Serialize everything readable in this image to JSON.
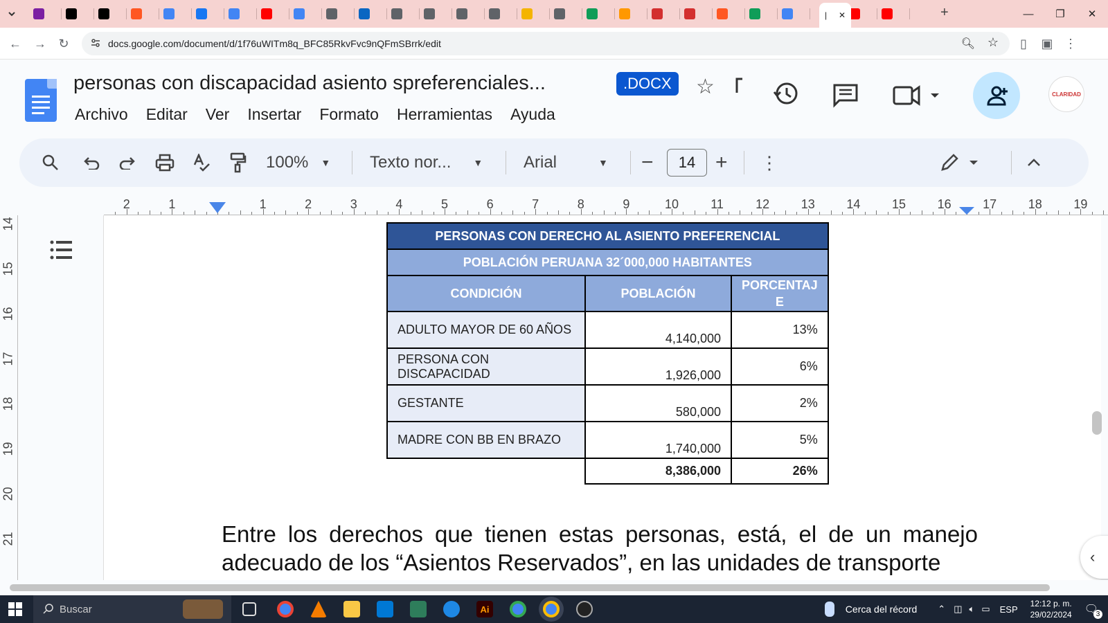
{
  "browser": {
    "active_tab_label": "|",
    "url": "docs.google.com/document/d/1f76uWITm8q_BFC85RkvFvc9nQFmSBrrk/edit",
    "tab_colors": [
      "#7b1fa2",
      "#000000",
      "#000000",
      "#ff5722",
      "#4285f4",
      "#1877f2",
      "#4285f4",
      "#ff0000",
      "#4285f4",
      "#5f6368",
      "#0a66c2",
      "#5f6368",
      "#5f6368",
      "#5f6368",
      "#5f6368",
      "#f4b400",
      "#5f6368",
      "#0f9d58",
      "#ff9800",
      "#d32f2f",
      "#d32f2f",
      "#ff5722",
      "#0f9d58",
      "#4285f4",
      "#ff0000",
      "#ff0000"
    ]
  },
  "docs": {
    "title": "personas con discapacidad asiento spreferenciales...",
    "format_badge": ".DOCX",
    "menu": [
      "Archivo",
      "Editar",
      "Ver",
      "Insertar",
      "Formato",
      "Herramientas",
      "Ayuda"
    ],
    "avatar_text": "CLARIDAD"
  },
  "toolbar": {
    "zoom": "100%",
    "style": "Texto nor...",
    "font": "Arial",
    "font_size": "14"
  },
  "ruler": {
    "horizontal": [
      "2",
      "1",
      "1",
      "2",
      "3",
      "4",
      "5",
      "6",
      "7",
      "8",
      "9",
      "10",
      "11",
      "12",
      "13",
      "14",
      "15",
      "16",
      "17",
      "18",
      "19"
    ],
    "vertical": [
      "14",
      "15",
      "16",
      "17",
      "18",
      "19",
      "20",
      "21"
    ]
  },
  "table": {
    "title": "PERSONAS CON DERECHO AL ASIENTO PREFERENCIAL",
    "subtitle": "POBLACIÓN PERUANA 32´000,000 HABITANTES",
    "col_condicion": "CONDICIÓN",
    "col_poblacion": "POBLACIÓN",
    "col_porcentaje": "PORCENTAJ E",
    "rows": [
      {
        "condicion": "ADULTO MAYOR DE 60 AÑOS",
        "poblacion": "4,140,000",
        "porcentaje": "13%"
      },
      {
        "condicion": "PERSONA CON DISCAPACIDAD",
        "poblacion": "1,926,000",
        "porcentaje": "6%"
      },
      {
        "condicion": "GESTANTE",
        "poblacion": "580,000",
        "porcentaje": "2%"
      },
      {
        "condicion": "MADRE CON BB EN BRAZO",
        "poblacion": "1,740,000",
        "porcentaje": "5%"
      }
    ],
    "total_poblacion": "8,386,000",
    "total_porcentaje": "26%"
  },
  "body_text": "Entre los derechos que tienen estas personas, está, el de un manejo adecuado de los “Asientos Reservados”, en las unidades de transporte",
  "taskbar": {
    "search_placeholder": "Buscar",
    "weather": "Cerca del récord",
    "language": "ESP",
    "time": "12:12 p. m.",
    "date": "29/02/2024",
    "notifications": "3"
  }
}
